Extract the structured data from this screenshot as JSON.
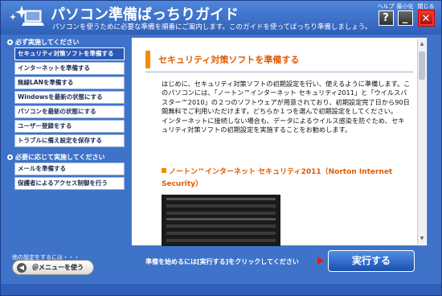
{
  "header": {
    "title": "パソコン準備ばっちりガイド",
    "subtitle": "パソコンを使うために必要な準備を順番にご案内します。このガイドを使ってばっちり準備しましょう。",
    "help_label": "ヘルプ",
    "help_icon": "?",
    "minimize_label": "最小化",
    "minimize_icon": "_",
    "close_label": "閉じる",
    "close_icon": "✕"
  },
  "sidebar": {
    "section1_title": "必ず実施してください",
    "section1_items": [
      "セキュリティ対策ソフトを準備する",
      "インターネットを準備する",
      "無線LANを準備する",
      "Windowsを最新の状態にする",
      "パソコンを最新の状態にする",
      "ユーザー登録をする",
      "トラブルに備え設定を保存する"
    ],
    "section2_title": "必要に応じて実施してください",
    "section2_items": [
      "メールを準備する",
      "保護者によるアクセス制御を行う"
    ],
    "other_settings_text": "他の設定をするには・・・",
    "menu_button_label": "＠メニューを使う"
  },
  "content": {
    "title": "セキュリティ対策ソフトを準備する",
    "paragraph1": "はじめに、セキュリティ対策ソフトの初期設定を行い、使えるように準備します。このパソコンには、「ノートン™インターネット セキュリティ2011」と「ウイルスバスター™2010」の２つのソフトウェアが用意されており、初期設定完了日から90日間無料でご利用いただけます。どちらか１つを選んで初期設定をしてください。",
    "paragraph2": "インターネットに接続しない場合も、データによるウイルス感染を防ぐため、セキュリティ対策ソフトの初期設定を実施することをお勧めします。",
    "subheading": "ノートン™インターネット セキュリティ2011（Norton Internet Security）"
  },
  "bottom": {
    "hint": "準備を始めるには[実行する]をクリックしてください",
    "run_button_label": "実行する"
  },
  "colors": {
    "window_blue": "#3f73c9",
    "accent_orange": "#f28c00",
    "title_orange": "#e05a00",
    "run_button_blue": "#1b4fb0",
    "close_red": "#e23a2a"
  },
  "icons": {
    "logo": "laptop-sparkle-icon",
    "help": "question-mark-icon",
    "minimize": "minimize-icon",
    "close": "close-x-icon",
    "section_bullet": "circle-bullet-icon",
    "menu_arrow": "circle-arrow-icon",
    "hint_arrow": "red-triangle-right-icon"
  }
}
